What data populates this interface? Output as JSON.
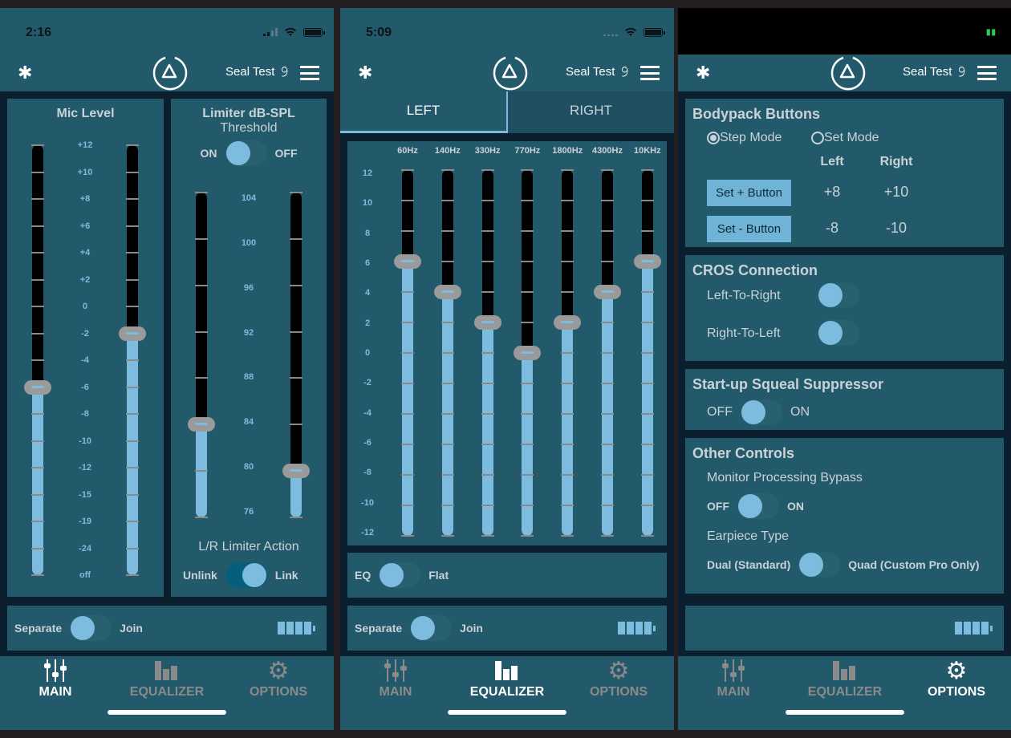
{
  "common": {
    "app_header": {
      "seal_test_label": "Seal Test"
    },
    "tabs": [
      {
        "label": "MAIN",
        "icon": "sliders-icon"
      },
      {
        "label": "EQUALIZER",
        "icon": "equalizer-bars-icon"
      },
      {
        "label": "OPTIONS",
        "icon": "gear-icon"
      }
    ],
    "separate_join": {
      "left_label": "Separate",
      "right_label": "Join",
      "state": "Separate"
    },
    "colors": {
      "accent": "#7dbcdf",
      "panel": "#235a6b",
      "background": "#0c1f2e",
      "thumb": "#9a9a9a"
    }
  },
  "screens": [
    {
      "status_time": "2:16",
      "active_tab": "MAIN",
      "mic_level": {
        "title": "Mic Level",
        "scale": [
          "+12",
          "+10",
          "+8",
          "+6",
          "+4",
          "+2",
          "0",
          "-2",
          "-4",
          "-6",
          "-8",
          "-10",
          "-12",
          "-15",
          "-19",
          "-24",
          "off"
        ],
        "left_value": "-6",
        "right_value": "-2"
      },
      "limiter": {
        "title": "Limiter dB-SPL",
        "subtitle": "Threshold",
        "toggle_on_label": "ON",
        "toggle_off_label": "OFF",
        "toggle_state": "ON",
        "scale": [
          "104",
          "100",
          "96",
          "92",
          "88",
          "84",
          "80",
          "76"
        ],
        "left_value": 84,
        "right_value": 80,
        "lr_action_title": "L/R Limiter Action",
        "unlink_label": "Unlink",
        "link_label": "Link",
        "lr_action_state": "Link"
      }
    },
    {
      "status_time": "5:09",
      "active_tab": "EQUALIZER",
      "channel_tabs": [
        "LEFT",
        "RIGHT"
      ],
      "active_channel": "LEFT",
      "bands": [
        "60Hz",
        "140Hz",
        "330Hz",
        "770Hz",
        "1800Hz",
        "4300Hz",
        "10KHz"
      ],
      "band_values": [
        6,
        4,
        2,
        0,
        2,
        4,
        6
      ],
      "scale": [
        "12",
        "10",
        "8",
        "6",
        "4",
        "2",
        "0",
        "-2",
        "-4",
        "-6",
        "-8",
        "-10",
        "-12"
      ],
      "eq_flat": {
        "left_label": "EQ",
        "right_label": "Flat",
        "state": "EQ"
      }
    },
    {
      "active_tab": "OPTIONS",
      "bodypack": {
        "title": "Bodypack Buttons",
        "modes": [
          "Step Mode",
          "Set Mode"
        ],
        "selected_mode": "Step Mode",
        "col_left": "Left",
        "col_right": "Right",
        "rows": [
          {
            "button": "Set + Button",
            "left": "+8",
            "right": "+10"
          },
          {
            "button": "Set - Button",
            "left": "-8",
            "right": "-10"
          }
        ]
      },
      "cros": {
        "title": "CROS Connection",
        "items": [
          {
            "label": "Left-To-Right",
            "state": "off"
          },
          {
            "label": "Right-To-Left",
            "state": "off"
          }
        ]
      },
      "squeal": {
        "title": "Start-up Squeal Suppressor",
        "off_label": "OFF",
        "on_label": "ON",
        "state": "OFF"
      },
      "other": {
        "title": "Other Controls",
        "bypass_label": "Monitor Processing Bypass",
        "bypass_off": "OFF",
        "bypass_on": "ON",
        "bypass_state": "OFF",
        "earpiece_label": "Earpiece Type",
        "earpiece_left": "Dual (Standard)",
        "earpiece_right": "Quad (Custom Pro Only)",
        "earpiece_state": "Dual (Standard)"
      }
    }
  ]
}
